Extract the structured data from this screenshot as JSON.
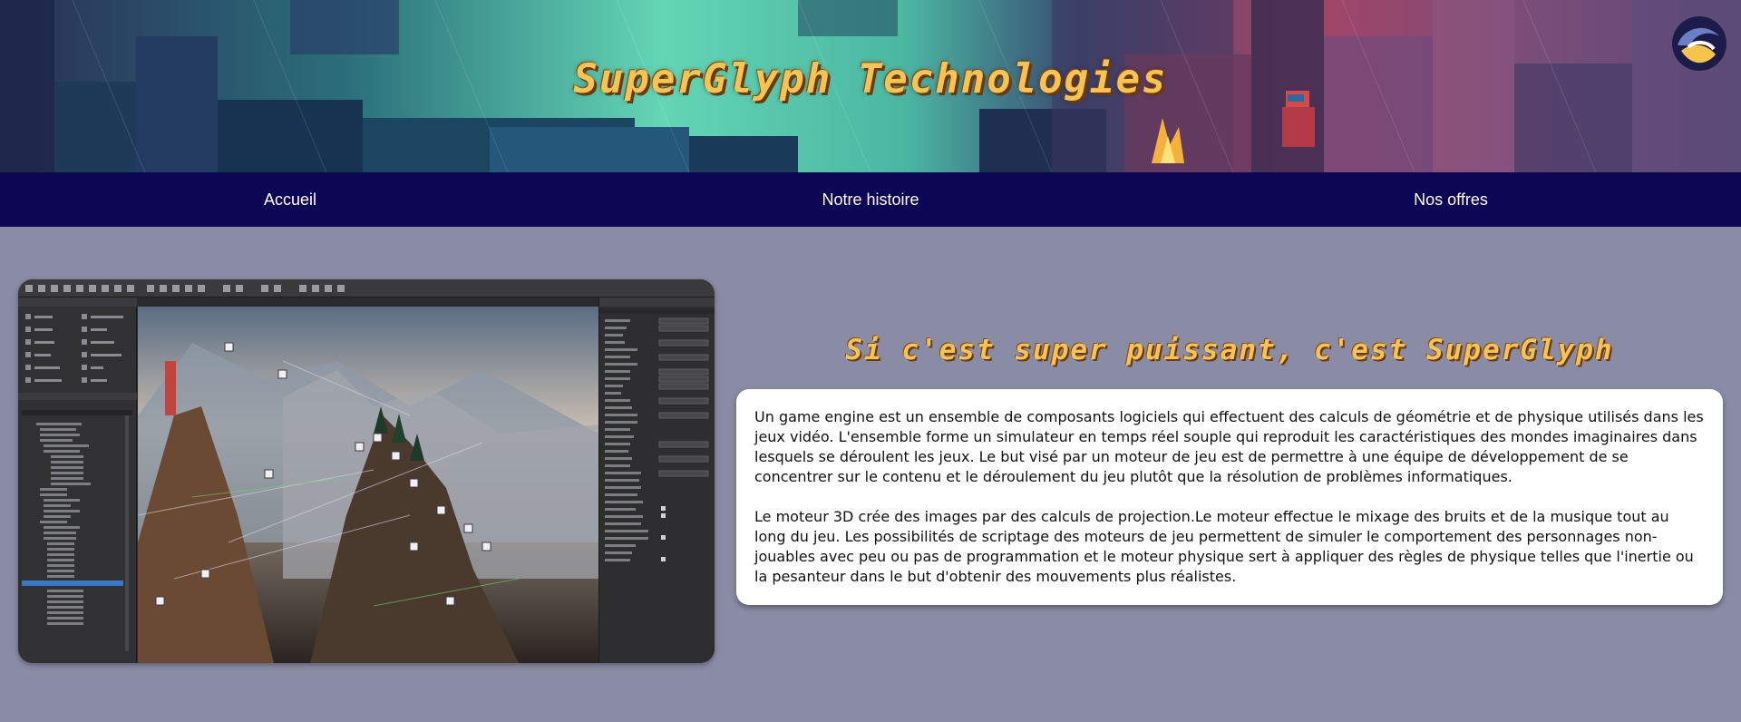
{
  "header": {
    "brand_title": "SuperGlyph Technologies",
    "logo_icon": "swirl-logo-icon"
  },
  "nav": {
    "items": [
      {
        "label": "Accueil"
      },
      {
        "label": "Notre histoire"
      },
      {
        "label": "Nos offres"
      }
    ]
  },
  "main": {
    "image_icon": "game-engine-editor-screenshot",
    "section_title": "Si c'est super puissant, c'est SuperGlyph",
    "paragraphs": [
      "Un game engine est un ensemble de composants logiciels qui effectuent des calculs de géométrie et de physique utilisés dans les jeux vidéo. L'ensemble forme un simulateur en temps réel souple qui reproduit les caractéristiques des mondes imaginaires dans lesquels se déroulent les jeux. Le but visé par un moteur de jeu est de permettre à une équipe de développement de se concentrer sur le contenu et le déroulement du jeu plutôt que la résolution de problèmes informatiques.",
      "Le moteur 3D crée des images par des calculs de projection.Le moteur effectue le mixage des bruits et de la musique tout au long du jeu. Les possibilités de scriptage des moteurs de jeu permettent de simuler le comportement des personnages non-jouables avec peu ou pas de programmation et le moteur physique sert à appliquer des règles de physique telles que l'inertie ou la pesanteur dans le but d'obtenir des mouvements plus réalistes."
    ]
  },
  "colors": {
    "page_background": "#8a8ba4",
    "nav_background": "#0c0654",
    "title_color": "#f6c453",
    "card_background": "#ffffff"
  }
}
